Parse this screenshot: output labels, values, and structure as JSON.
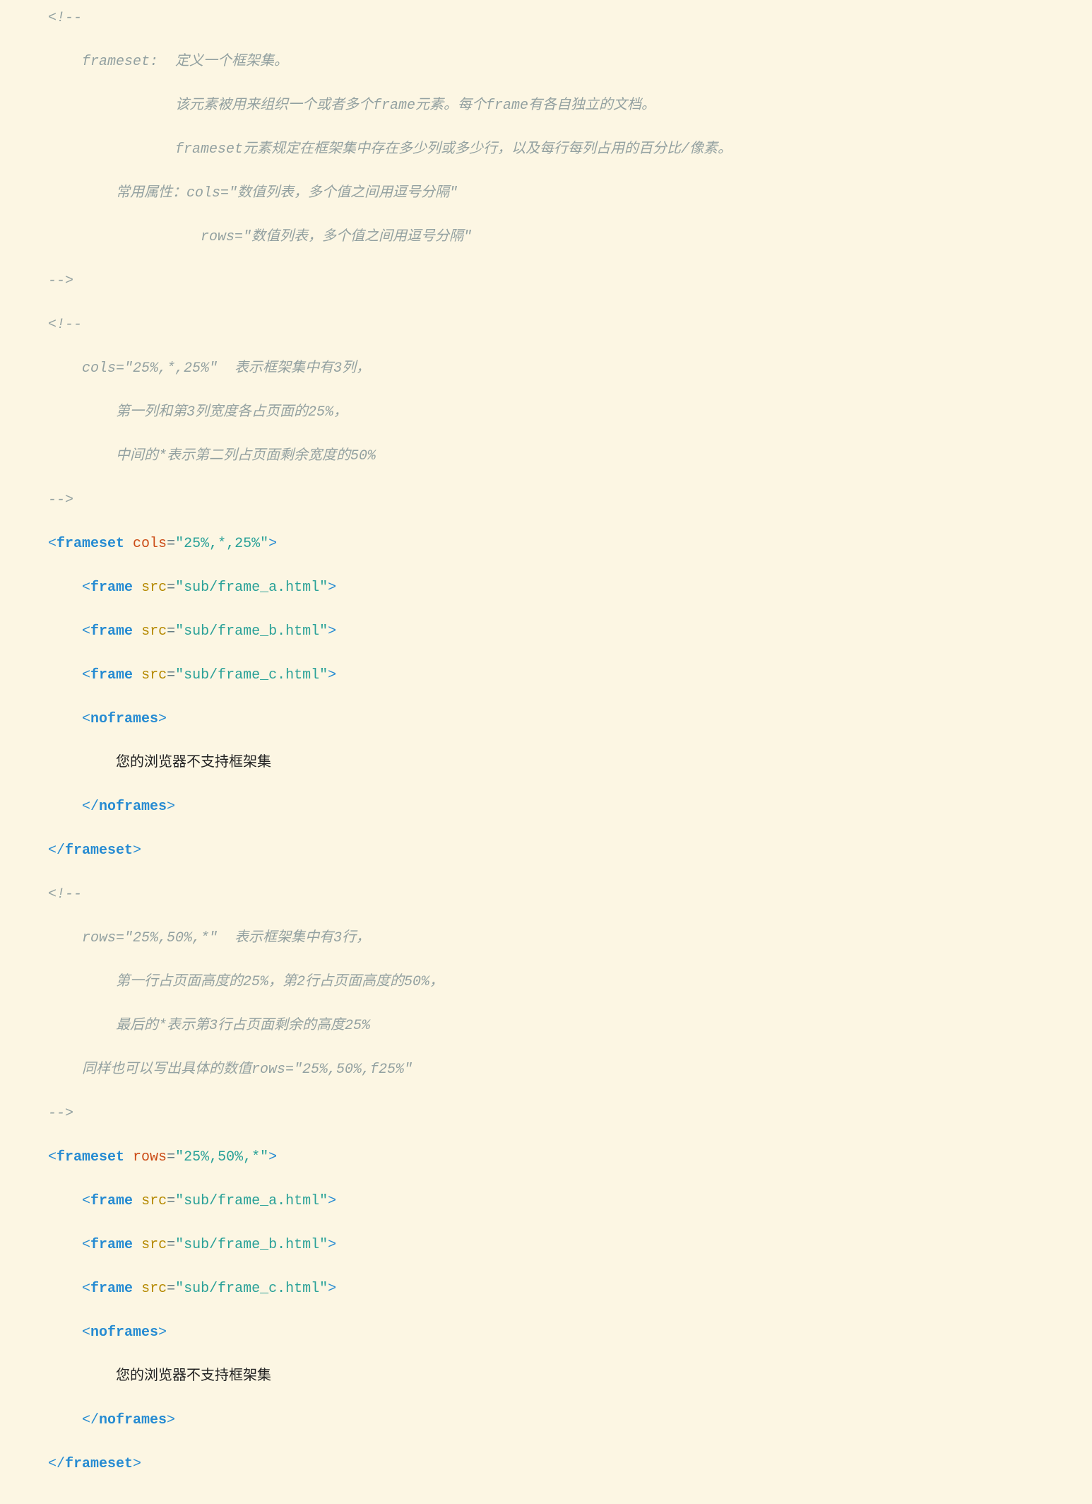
{
  "lines": [
    {
      "text": "    <!--",
      "cls": "comment"
    },
    {
      "text": "        frameset:  定义一个框架集。",
      "cls": "comment"
    },
    {
      "text": "                   该元素被用来组织一个或者多个frame元素。每个frame有各自独立的文档。",
      "cls": "comment"
    },
    {
      "text": "                   frameset元素规定在框架集中存在多少列或多少行，以及每行每列占用的百分比/像素。",
      "cls": "comment"
    },
    {
      "text": "            常用属性：cols=\"数值列表，多个值之间用逗号分隔\"",
      "cls": "comment"
    },
    {
      "text": "                      rows=\"数值列表，多个值之间用逗号分隔\"",
      "cls": "comment"
    },
    {
      "text": "    -->",
      "cls": "comment"
    },
    {
      "text": "    <!--",
      "cls": "comment"
    },
    {
      "text": "        cols=\"25%,*,25%\"  表示框架集中有3列，",
      "cls": "comment"
    },
    {
      "text": "            第一列和第3列宽度各占页面的25%，",
      "cls": "comment"
    },
    {
      "text": "            中间的*表示第二列占页面剩余宽度的50%",
      "cls": "comment"
    },
    {
      "text": "    -->",
      "cls": "comment"
    },
    {
      "parts": [
        {
          "t": "    <",
          "c": "tag-bracket"
        },
        {
          "t": "frameset",
          "c": "tag-name"
        },
        {
          "t": " ",
          "c": ""
        },
        {
          "t": "cols",
          "c": "attr-name-red"
        },
        {
          "t": "=",
          "c": "attr-eq"
        },
        {
          "t": "\"25%,*,25%\"",
          "c": "attr-value"
        },
        {
          "t": ">",
          "c": "tag-bracket"
        }
      ]
    },
    {
      "parts": [
        {
          "t": "        <",
          "c": "tag-bracket"
        },
        {
          "t": "frame",
          "c": "tag-name"
        },
        {
          "t": " ",
          "c": ""
        },
        {
          "t": "src",
          "c": "attr-name"
        },
        {
          "t": "=",
          "c": "attr-eq"
        },
        {
          "t": "\"sub/frame_a.html\"",
          "c": "attr-value"
        },
        {
          "t": ">",
          "c": "tag-bracket"
        }
      ]
    },
    {
      "parts": [
        {
          "t": "        <",
          "c": "tag-bracket"
        },
        {
          "t": "frame",
          "c": "tag-name"
        },
        {
          "t": " ",
          "c": ""
        },
        {
          "t": "src",
          "c": "attr-name"
        },
        {
          "t": "=",
          "c": "attr-eq"
        },
        {
          "t": "\"sub/frame_b.html\"",
          "c": "attr-value"
        },
        {
          "t": ">",
          "c": "tag-bracket"
        }
      ]
    },
    {
      "parts": [
        {
          "t": "        <",
          "c": "tag-bracket"
        },
        {
          "t": "frame",
          "c": "tag-name"
        },
        {
          "t": " ",
          "c": ""
        },
        {
          "t": "src",
          "c": "attr-name"
        },
        {
          "t": "=",
          "c": "attr-eq"
        },
        {
          "t": "\"sub/frame_c.html\"",
          "c": "attr-value"
        },
        {
          "t": ">",
          "c": "tag-bracket"
        }
      ]
    },
    {
      "parts": [
        {
          "t": "        <",
          "c": "tag-bracket"
        },
        {
          "t": "noframes",
          "c": "tag-name"
        },
        {
          "t": ">",
          "c": "tag-bracket"
        }
      ]
    },
    {
      "parts": [
        {
          "t": "            您的浏览器不支持框架集",
          "c": "text-black"
        }
      ]
    },
    {
      "parts": [
        {
          "t": "        </",
          "c": "tag-bracket"
        },
        {
          "t": "noframes",
          "c": "tag-name"
        },
        {
          "t": ">",
          "c": "tag-bracket"
        }
      ]
    },
    {
      "parts": [
        {
          "t": "    </",
          "c": "tag-bracket"
        },
        {
          "t": "frameset",
          "c": "tag-name"
        },
        {
          "t": ">",
          "c": "tag-bracket"
        }
      ]
    },
    {
      "text": "    <!--",
      "cls": "comment"
    },
    {
      "text": "        rows=\"25%,50%,*\"  表示框架集中有3行，",
      "cls": "comment"
    },
    {
      "text": "            第一行占页面高度的25%，第2行占页面高度的50%，",
      "cls": "comment"
    },
    {
      "text": "            最后的*表示第3行占页面剩余的高度25%",
      "cls": "comment"
    },
    {
      "text": "        同样也可以写出具体的数值rows=\"25%,50%,f25%\"",
      "cls": "comment"
    },
    {
      "text": "    -->",
      "cls": "comment"
    },
    {
      "parts": [
        {
          "t": "    <",
          "c": "tag-bracket"
        },
        {
          "t": "frameset",
          "c": "tag-name"
        },
        {
          "t": " ",
          "c": ""
        },
        {
          "t": "rows",
          "c": "attr-name-red"
        },
        {
          "t": "=",
          "c": "attr-eq"
        },
        {
          "t": "\"25%,50%,*\"",
          "c": "attr-value"
        },
        {
          "t": ">",
          "c": "tag-bracket"
        }
      ]
    },
    {
      "parts": [
        {
          "t": "        <",
          "c": "tag-bracket"
        },
        {
          "t": "frame",
          "c": "tag-name"
        },
        {
          "t": " ",
          "c": ""
        },
        {
          "t": "src",
          "c": "attr-name"
        },
        {
          "t": "=",
          "c": "attr-eq"
        },
        {
          "t": "\"sub/frame_a.html\"",
          "c": "attr-value"
        },
        {
          "t": ">",
          "c": "tag-bracket"
        }
      ]
    },
    {
      "parts": [
        {
          "t": "        <",
          "c": "tag-bracket"
        },
        {
          "t": "frame",
          "c": "tag-name"
        },
        {
          "t": " ",
          "c": ""
        },
        {
          "t": "src",
          "c": "attr-name"
        },
        {
          "t": "=",
          "c": "attr-eq"
        },
        {
          "t": "\"sub/frame_b.html\"",
          "c": "attr-value"
        },
        {
          "t": ">",
          "c": "tag-bracket"
        }
      ]
    },
    {
      "parts": [
        {
          "t": "        <",
          "c": "tag-bracket"
        },
        {
          "t": "frame",
          "c": "tag-name"
        },
        {
          "t": " ",
          "c": ""
        },
        {
          "t": "src",
          "c": "attr-name"
        },
        {
          "t": "=",
          "c": "attr-eq"
        },
        {
          "t": "\"sub/frame_c.html\"",
          "c": "attr-value"
        },
        {
          "t": ">",
          "c": "tag-bracket"
        }
      ]
    },
    {
      "parts": [
        {
          "t": "        <",
          "c": "tag-bracket"
        },
        {
          "t": "noframes",
          "c": "tag-name"
        },
        {
          "t": ">",
          "c": "tag-bracket"
        }
      ]
    },
    {
      "parts": [
        {
          "t": "            您的浏览器不支持框架集",
          "c": "text-black"
        }
      ]
    },
    {
      "parts": [
        {
          "t": "        </",
          "c": "tag-bracket"
        },
        {
          "t": "noframes",
          "c": "tag-name"
        },
        {
          "t": ">",
          "c": "tag-bracket"
        }
      ]
    },
    {
      "parts": [
        {
          "t": "    </",
          "c": "tag-bracket"
        },
        {
          "t": "frameset",
          "c": "tag-name"
        },
        {
          "t": ">",
          "c": "tag-bracket"
        }
      ]
    }
  ]
}
